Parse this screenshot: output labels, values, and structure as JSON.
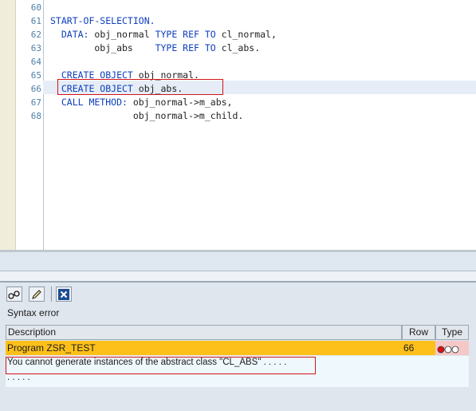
{
  "editor": {
    "lines": [
      {
        "no": "60",
        "segs": []
      },
      {
        "no": "61",
        "segs": [
          {
            "t": "START-OF-SELECTION.",
            "kw": true
          }
        ]
      },
      {
        "no": "62",
        "segs": [
          {
            "t": "  DATA: ",
            "kw": true
          },
          {
            "t": "obj_normal ",
            "kw": false
          },
          {
            "t": "TYPE REF TO ",
            "kw": true
          },
          {
            "t": "cl_normal,",
            "kw": false
          }
        ]
      },
      {
        "no": "63",
        "segs": [
          {
            "t": "        obj_abs    ",
            "kw": false
          },
          {
            "t": "TYPE REF TO ",
            "kw": true
          },
          {
            "t": "cl_abs.",
            "kw": false
          }
        ]
      },
      {
        "no": "64",
        "segs": []
      },
      {
        "no": "65",
        "segs": [
          {
            "t": "  CREATE OBJECT ",
            "kw": true
          },
          {
            "t": "obj_normal.",
            "kw": false
          }
        ]
      },
      {
        "no": "66",
        "segs": [
          {
            "t": "  CREATE OBJECT ",
            "kw": true
          },
          {
            "t": "obj_abs.",
            "kw": false
          }
        ]
      },
      {
        "no": "67",
        "segs": [
          {
            "t": "  CALL METHOD: ",
            "kw": true
          },
          {
            "t": "obj_normal->m_abs,",
            "kw": false
          }
        ]
      },
      {
        "no": "68",
        "segs": [
          {
            "t": "               obj_normal->m_child.",
            "kw": false
          }
        ]
      }
    ]
  },
  "toolbar": {
    "buttons": [
      {
        "name": "glasses-icon",
        "label": "Display"
      },
      {
        "name": "pencil-icon",
        "label": "Edit"
      },
      {
        "name": "close-icon",
        "label": "Close"
      }
    ]
  },
  "errors": {
    "title": "Syntax error",
    "columns": {
      "description": "Description",
      "row": "Row",
      "type": "Type"
    },
    "program": {
      "description": "Program ZSR_TEST",
      "row": "66"
    },
    "message": "You cannot generate instances of the abstract class \"CL_ABS\" . . . . .",
    "message_cont": ". . . . .",
    "type_status": "error",
    "colors": {
      "error_light": "#e01010",
      "inactive_light": "#ffffff",
      "highlight_row": "#fdc01a",
      "type_cell": "#f5c8c8",
      "message_bg": "#eef8fd",
      "keyword": "#0e3fbe",
      "marker": "#d4141a"
    }
  }
}
